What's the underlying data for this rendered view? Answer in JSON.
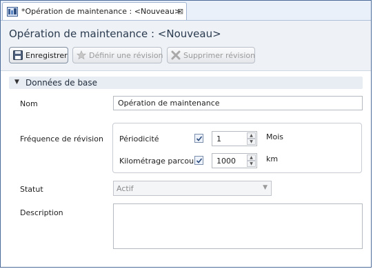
{
  "tab": {
    "title": "*Opération de maintenance : <Nouveau>",
    "close_glyph": "⊠"
  },
  "header": {
    "title": "Opération de maintenance : <Nouveau>"
  },
  "toolbar": {
    "save_label": "Enregistrer",
    "define_revision_label": "Définir une révision",
    "delete_revision_label": "Supprimer révision"
  },
  "section": {
    "title": "Données de base",
    "expanded_glyph": "▼"
  },
  "form": {
    "name_label": "Nom",
    "name_value": "Opération de maintenance",
    "frequency_label": "Fréquence de révision",
    "periodicity_label": "Périodicité",
    "periodicity_checked": true,
    "periodicity_value": "1",
    "periodicity_unit": "Mois",
    "mileage_label": "Kilométrage parcou",
    "mileage_checked": true,
    "mileage_value": "1000",
    "mileage_unit": "km",
    "status_label": "Statut",
    "status_value": "Actif",
    "description_label": "Description",
    "description_value": ""
  },
  "icons": {
    "tab_icon": "maintenance-editor-icon",
    "save": "floppy-disk-icon",
    "define_revision": "star-icon",
    "delete_revision": "cross-icon"
  },
  "colors": {
    "accent": "#4a6a9a",
    "section_bg": "#e8edf3",
    "header_bg": "#eef2f7"
  }
}
